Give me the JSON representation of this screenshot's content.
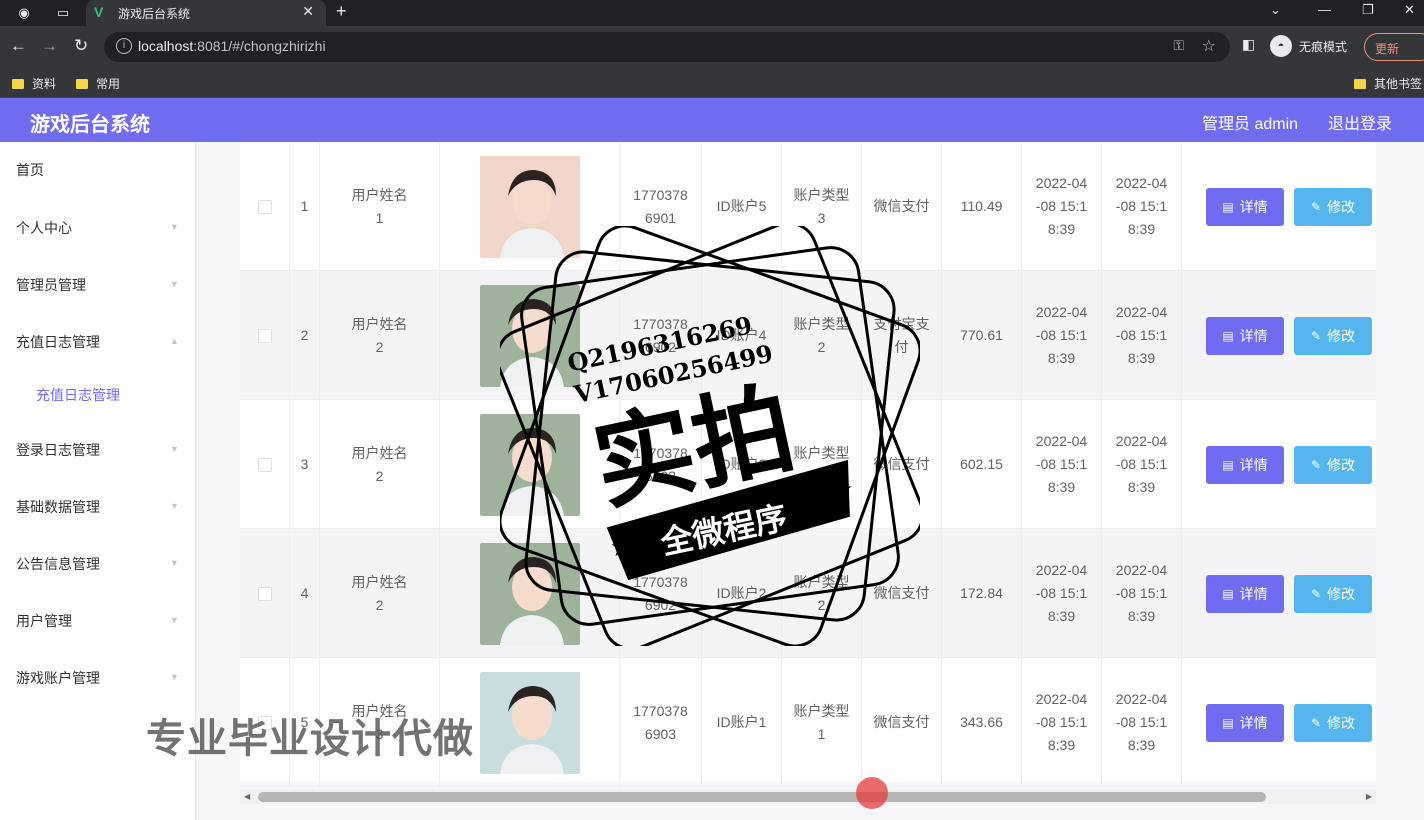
{
  "browser": {
    "tab_title": "游戏后台系统",
    "url_host": "localhost",
    "url_rest": ":8081/#/chongzhirizhi",
    "incognito_label": "无痕模式",
    "update_label": "更新",
    "bookmarks": [
      "资料",
      "常用"
    ],
    "other_bookmarks": "其他书签"
  },
  "header": {
    "title": "游戏后台系统",
    "user": "管理员 admin",
    "logout": "退出登录"
  },
  "sidebar": {
    "items": [
      {
        "label": "首页"
      },
      {
        "label": "个人中心"
      },
      {
        "label": "管理员管理"
      },
      {
        "label": "充值日志管理"
      },
      {
        "label": "充值日志管理",
        "sub": true
      },
      {
        "label": "登录日志管理"
      },
      {
        "label": "基础数据管理"
      },
      {
        "label": "公告信息管理"
      },
      {
        "label": "用户管理"
      },
      {
        "label": "游戏账户管理"
      }
    ]
  },
  "table": {
    "detail_label": "详情",
    "edit_label": "修改",
    "rows": [
      {
        "index": "1",
        "name": "用户姓名\n1",
        "phone": "1770378\n6901",
        "account": "ID账户5",
        "type": "账户类型\n3",
        "pay": "微信支付",
        "amount": "110.49",
        "time1": "2022-04\n-08 15:1\n8:39",
        "time2": "2022-04\n-08 15:1\n8:39"
      },
      {
        "index": "2",
        "name": "用户姓名\n2",
        "phone": "1770378\n6902",
        "account": "ID账户4",
        "type": "账户类型\n2",
        "pay": "支付宝支\n付",
        "amount": "770.61",
        "time1": "2022-04\n-08 15:1\n8:39",
        "time2": "2022-04\n-08 15:1\n8:39"
      },
      {
        "index": "3",
        "name": "用户姓名\n2",
        "phone": "1770378\n6902",
        "account": "ID账户3",
        "type": "账户类型\n2",
        "pay": "微信支付",
        "amount": "602.15",
        "time1": "2022-04\n-08 15:1\n8:39",
        "time2": "2022-04\n-08 15:1\n8:39"
      },
      {
        "index": "4",
        "name": "用户姓名\n2",
        "phone": "1770378\n6902",
        "account": "ID账户2",
        "type": "账户类型\n2",
        "pay": "微信支付",
        "amount": "172.84",
        "time1": "2022-04\n-08 15:1\n8:39",
        "time2": "2022-04\n-08 15:1\n8:39"
      },
      {
        "index": "5",
        "name": "用户姓名\n3",
        "phone": "1770378\n6903",
        "account": "ID账户1",
        "type": "账户类型\n1",
        "pay": "微信支付",
        "amount": "343.66",
        "time1": "2022-04\n-08 15:1\n8:39",
        "time2": "2022-04\n-08 15:1\n8:39"
      }
    ]
  },
  "watermark": {
    "qq": "Q2196316269",
    "wechat": "V17060256499",
    "big": "实拍",
    "banner": "全微程序",
    "bottom": "专业毕业设计代做"
  },
  "colors": {
    "accent": "#6f6cf0",
    "edit_button": "#55b6ee"
  }
}
